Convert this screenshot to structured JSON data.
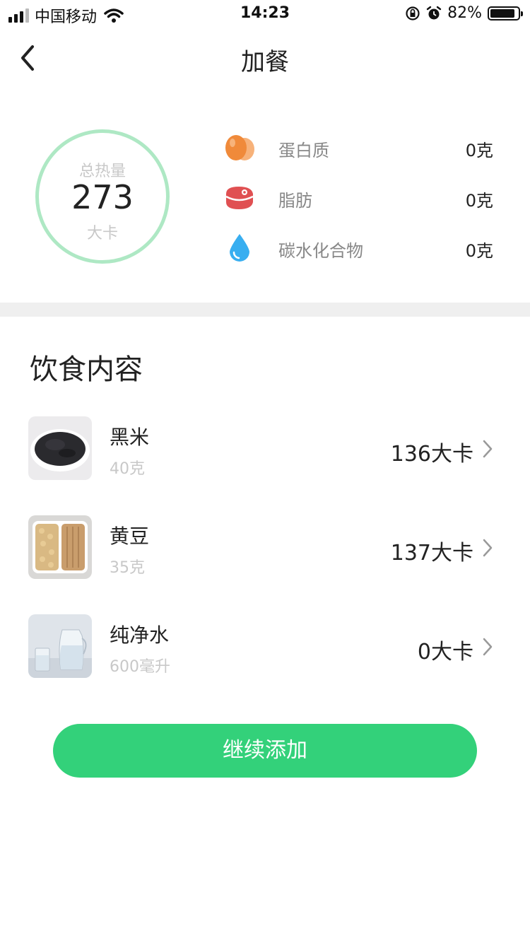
{
  "status_bar": {
    "carrier": "中国移动",
    "time": "14:23",
    "battery": "82%"
  },
  "nav": {
    "title": "加餐"
  },
  "summary": {
    "total_label": "总热量",
    "total_value": "273",
    "total_unit": "大卡",
    "nutrients": [
      {
        "name": "蛋白质",
        "amount": "0克",
        "icon": "egg-icon"
      },
      {
        "name": "脂肪",
        "amount": "0克",
        "icon": "meat-icon"
      },
      {
        "name": "碳水化合物",
        "amount": "0克",
        "icon": "water-drop-icon"
      }
    ]
  },
  "diet": {
    "title": "饮食内容",
    "items": [
      {
        "name": "黑米",
        "amount": "40克",
        "calories": "136大卡",
        "thumb": "black-rice-image"
      },
      {
        "name": "黄豆",
        "amount": "35克",
        "calories": "137大卡",
        "thumb": "soybean-image"
      },
      {
        "name": "纯净水",
        "amount": "600毫升",
        "calories": "0大卡",
        "thumb": "water-image"
      }
    ]
  },
  "actions": {
    "continue_add": "继续添加"
  },
  "colors": {
    "accent": "#33d17a",
    "ring": "#aee8c4"
  }
}
